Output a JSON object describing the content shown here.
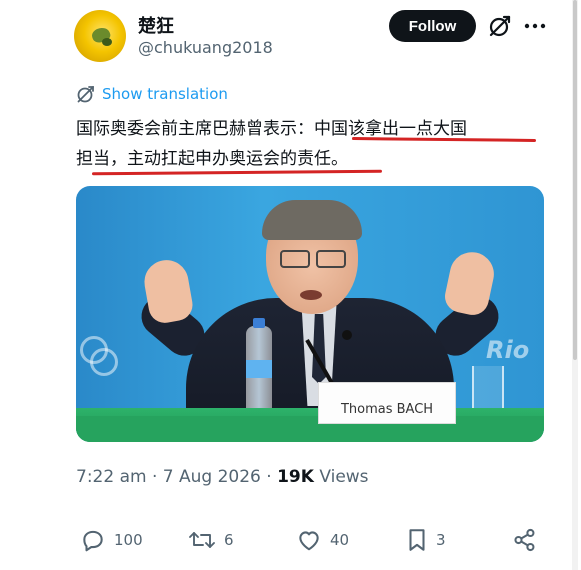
{
  "author": {
    "display_name": "楚狂",
    "handle": "@chukuang2018"
  },
  "header": {
    "follow_label": "Follow"
  },
  "translate": {
    "label": "Show translation"
  },
  "tweet": {
    "line1_plain": "国际奥委会前主席巴赫曾表示：",
    "line1_hl": "中国该拿出一点大国",
    "line2_hl": "担当，主动扛起申办奥运会的责任",
    "line2_end": "。"
  },
  "photo": {
    "nameplate": "Thomas BACH",
    "backdrop_text": "Rio"
  },
  "meta": {
    "time": "7:22 am",
    "sep1": " · ",
    "date": "7 Aug 2026",
    "sep2": " · ",
    "views_count": "19K",
    "views_label": " Views"
  },
  "actions": {
    "replies": "100",
    "reposts": "6",
    "likes": "40",
    "bookmarks": "3"
  },
  "colors": {
    "accent": "#1d9bf0",
    "underline": "#d42424",
    "text": "#0f1419",
    "muted": "#536471"
  },
  "icons": [
    "grok-icon",
    "more-icon",
    "translate-icon",
    "reply-icon",
    "repost-icon",
    "like-icon",
    "bookmark-icon",
    "share-icon"
  ]
}
